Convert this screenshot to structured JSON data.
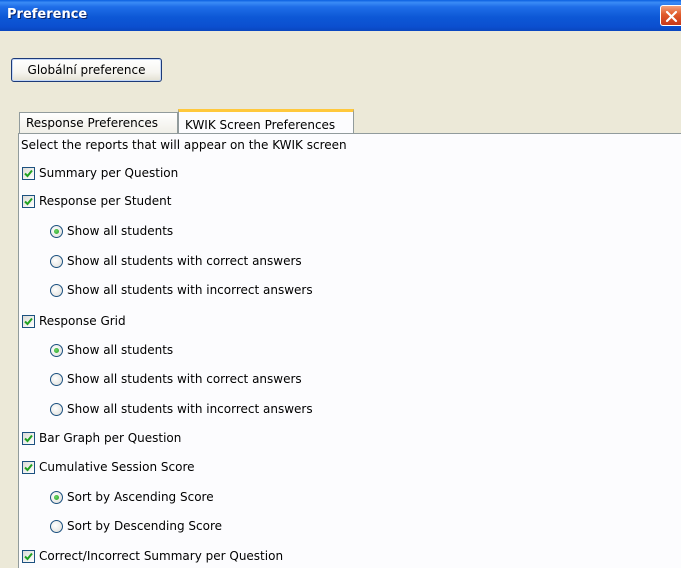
{
  "window": {
    "title": "Preference"
  },
  "global_button": {
    "label": "Globální preference"
  },
  "tabs": [
    {
      "label": "Response Preferences",
      "selected": false
    },
    {
      "label": "KWIK Screen Preferences",
      "selected": true
    }
  ],
  "panel": {
    "description": "Select the reports that will appear on the KWIK screen",
    "items": [
      {
        "type": "checkbox",
        "label": "Summary per Question",
        "checked": true
      },
      {
        "type": "checkbox",
        "label": "Response per Student",
        "checked": true
      },
      {
        "type": "radio",
        "label": "Show all students",
        "selected": true
      },
      {
        "type": "radio",
        "label": "Show all students with correct answers",
        "selected": false
      },
      {
        "type": "radio",
        "label": "Show all students with incorrect answers",
        "selected": false
      },
      {
        "type": "checkbox",
        "label": "Response Grid",
        "checked": true
      },
      {
        "type": "radio",
        "label": "Show all students",
        "selected": true
      },
      {
        "type": "radio",
        "label": "Show all students with correct answers",
        "selected": false
      },
      {
        "type": "radio",
        "label": "Show all students with incorrect answers",
        "selected": false
      },
      {
        "type": "checkbox",
        "label": "Bar Graph per Question",
        "checked": true
      },
      {
        "type": "checkbox",
        "label": "Cumulative Session Score",
        "checked": true
      },
      {
        "type": "radio",
        "label": "Sort by Ascending Score",
        "selected": true
      },
      {
        "type": "radio",
        "label": "Sort by Descending Score",
        "selected": false
      },
      {
        "type": "checkbox",
        "label": "Correct/Incorrect Summary per Question",
        "checked": true
      }
    ]
  },
  "colors": {
    "titlebar": "#0b55d4",
    "dialog_bg": "#ece9d8",
    "panel_bg": "#fcfcfe",
    "check_mark": "#21a121",
    "tab_highlight": "#ffc83c"
  }
}
